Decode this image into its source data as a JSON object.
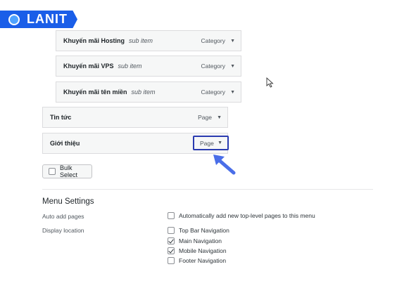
{
  "brand": {
    "logo_text": "LANIT"
  },
  "menu_items": [
    {
      "title": "Khuyến mãi Hosting",
      "subitem": "sub item",
      "type": "Category"
    },
    {
      "title": "Khuyến mãi VPS",
      "subitem": "sub item",
      "type": "Category"
    },
    {
      "title": "Khuyến mãi tên miền",
      "subitem": "sub item",
      "type": "Category"
    },
    {
      "title": "Tin tức",
      "type": "Page"
    },
    {
      "title": "Giới thiệu",
      "type": "Page"
    }
  ],
  "bulk_select": {
    "label": "Bulk Select",
    "checked": false
  },
  "menu_settings": {
    "title": "Menu Settings",
    "auto_add": {
      "label": "Auto add pages",
      "option": {
        "label": "Automatically add new top-level pages to this menu",
        "checked": false
      }
    },
    "display_location": {
      "label": "Display location",
      "options": [
        {
          "label": "Top Bar Navigation",
          "checked": false
        },
        {
          "label": "Main Navigation",
          "checked": true
        },
        {
          "label": "Mobile Navigation",
          "checked": true
        },
        {
          "label": "Footer Navigation",
          "checked": false
        }
      ]
    }
  },
  "colors": {
    "logo_bg": "#1a5ee8",
    "highlight_border": "#2a3bb0",
    "pointer_arrow": "#4a6ee8"
  }
}
